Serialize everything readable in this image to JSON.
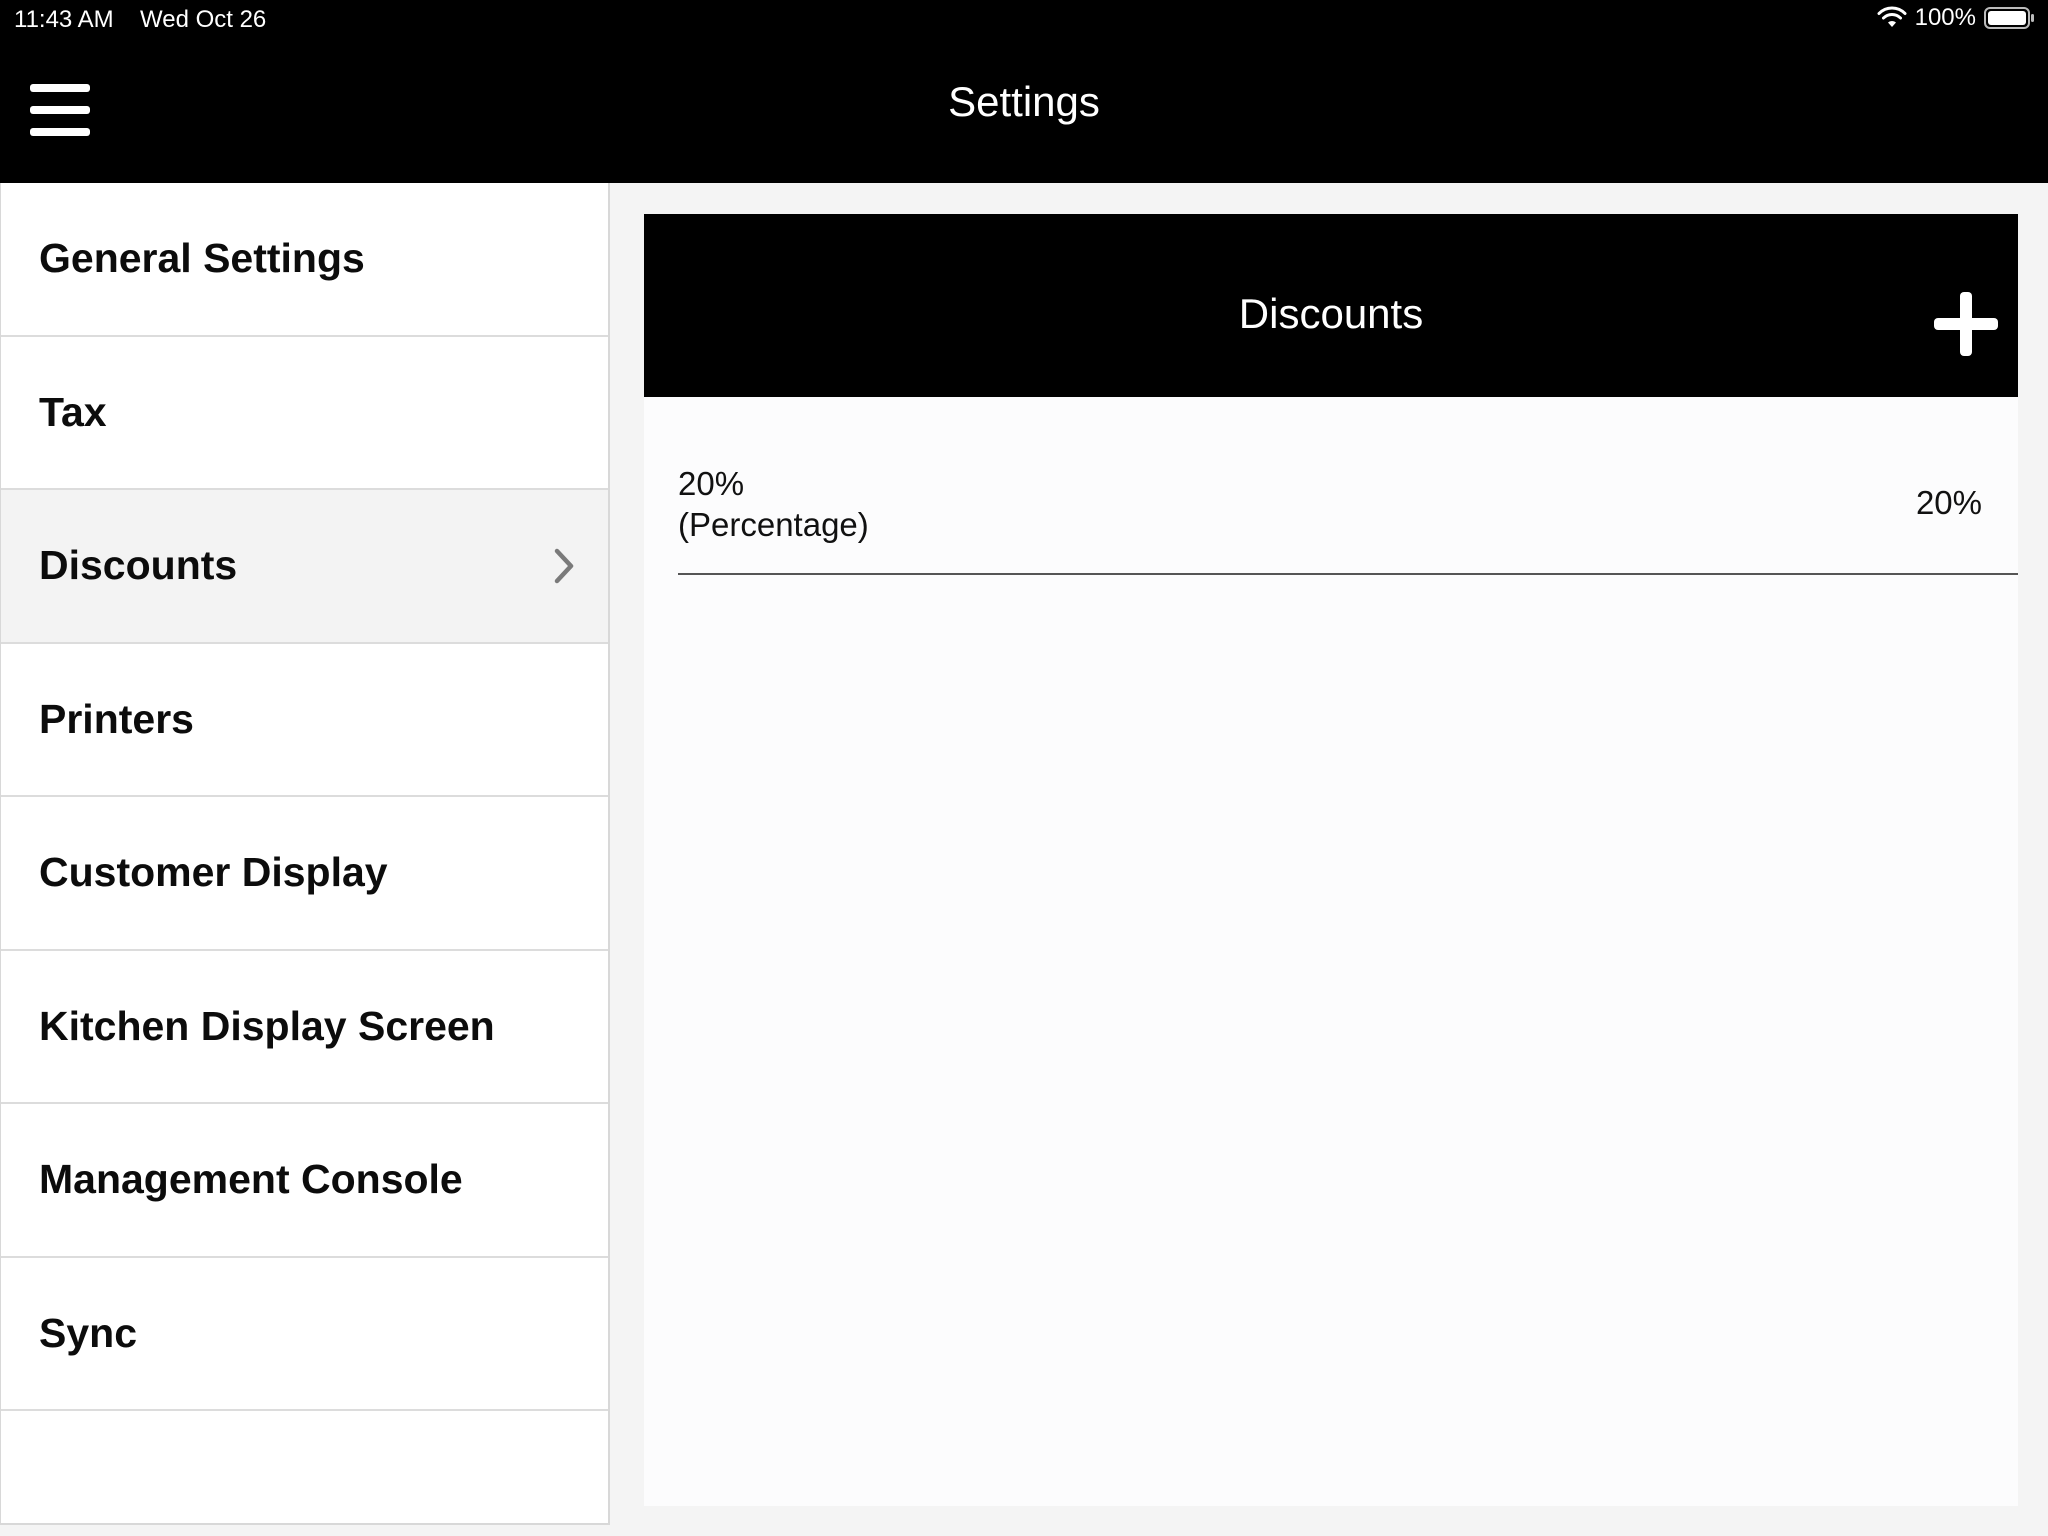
{
  "status_bar": {
    "time": "11:43 AM",
    "date": "Wed Oct 26",
    "battery": "100%",
    "icons": [
      "wifi-icon",
      "battery-icon"
    ]
  },
  "nav": {
    "title": "Settings",
    "menu_icon": "hamburger-menu-icon"
  },
  "sidebar": {
    "items": [
      {
        "label": "General Settings"
      },
      {
        "label": "Tax"
      },
      {
        "label": "Discounts",
        "selected": true,
        "icon": "chevron-right-icon"
      },
      {
        "label": "Printers"
      },
      {
        "label": "Customer Display"
      },
      {
        "label": "Kitchen Display Screen"
      },
      {
        "label": "Management Console"
      },
      {
        "label": "Sync"
      }
    ]
  },
  "panel": {
    "title": "Discounts",
    "add_icon": "plus-icon",
    "discounts": [
      {
        "name_line1": "20%",
        "name_line2": "(Percentage)",
        "value": "20%"
      }
    ]
  },
  "colors": {
    "header_bg": "#000000",
    "selected_row_bg": "#f3f3f3",
    "background": "#f4f4f4"
  }
}
